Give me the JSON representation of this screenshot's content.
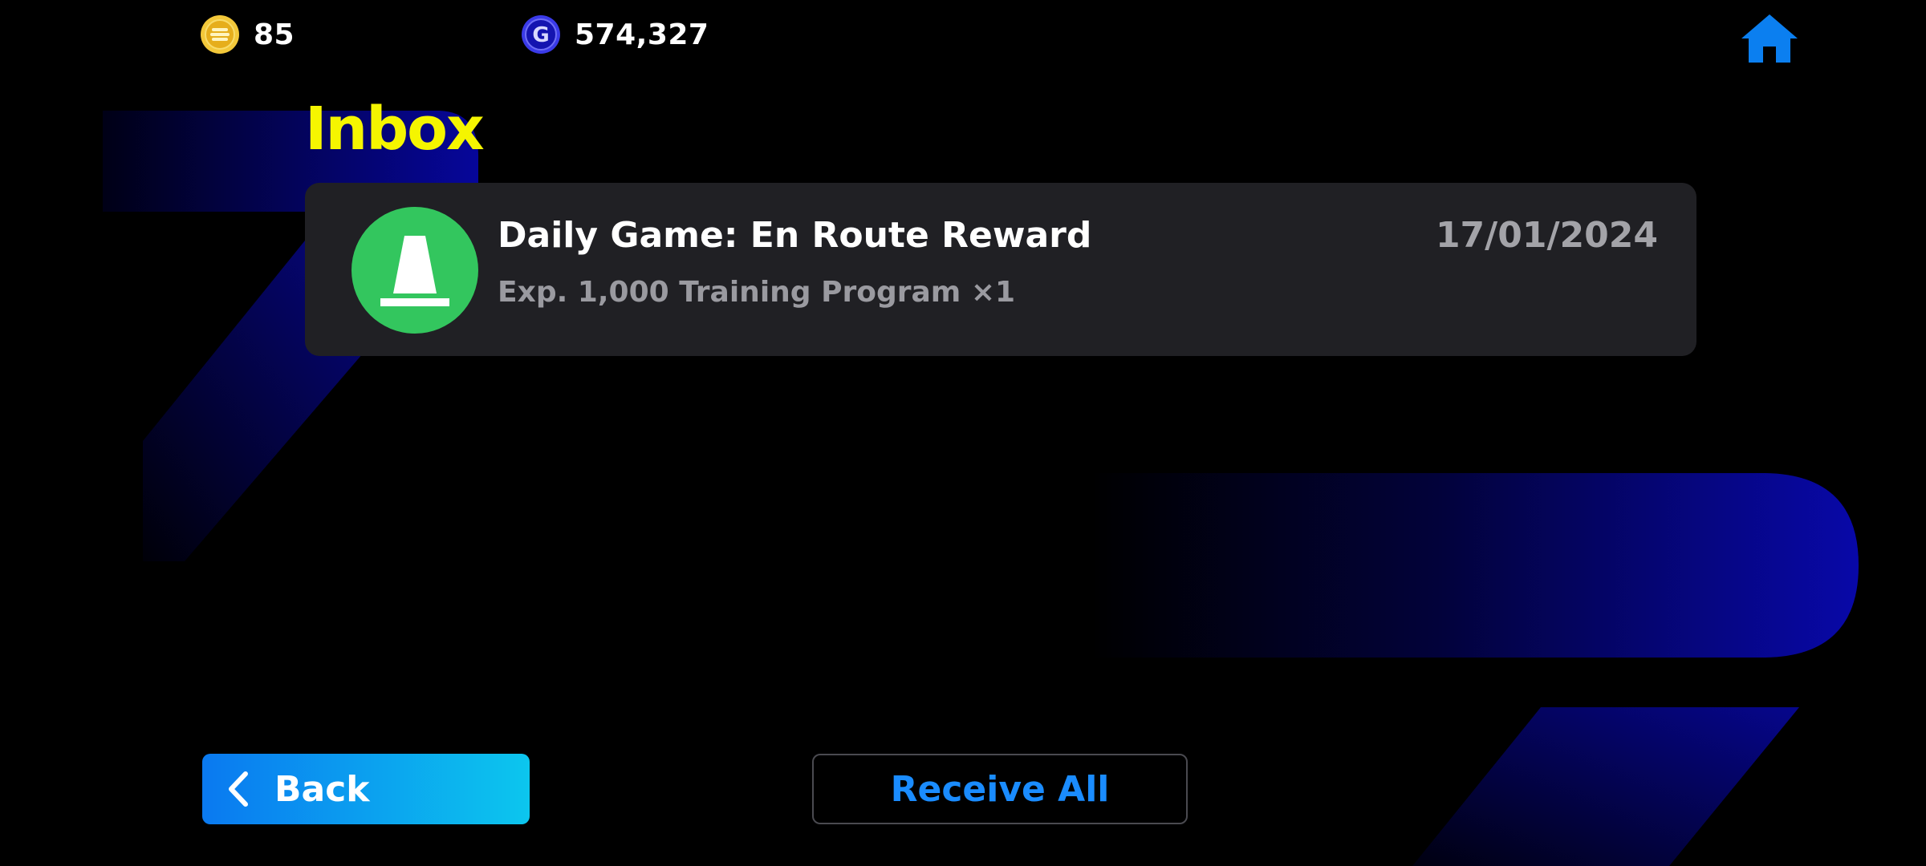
{
  "currencies": {
    "coins": {
      "icon": "coin-icon",
      "amount": "85",
      "color": "#f0c020"
    },
    "gp": {
      "icon": "gp-icon",
      "amount": "574,327",
      "color": "#2a2ad8"
    }
  },
  "header": {
    "title": "Inbox",
    "home_icon": "home-icon"
  },
  "mail_items": [
    {
      "icon": "training-cone-icon",
      "title": "Daily Game: En Route Reward",
      "subtitle": "Exp. 1,000 Training Program ×1",
      "date": "17/01/2024"
    }
  ],
  "footer": {
    "back_label": "Back",
    "receive_all_label": "Receive All"
  },
  "colors": {
    "title": "#f5f500",
    "accent_blue": "#1a8cff",
    "card_bg": "#202024",
    "badge_green": "#33c65e",
    "bg_shape_blue": "#0a0aa8"
  }
}
